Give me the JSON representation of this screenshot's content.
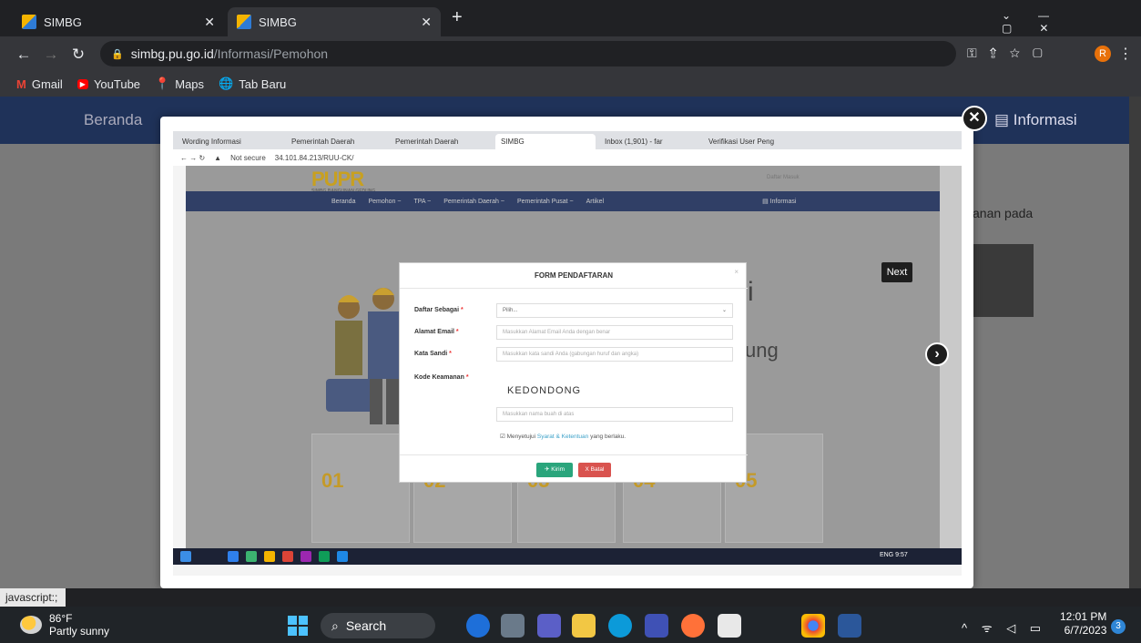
{
  "browser": {
    "tabs": [
      {
        "title": "SIMBG"
      },
      {
        "title": "SIMBG"
      }
    ],
    "url_host": "simbg.pu.go.id",
    "url_path": "/Informasi/Pemohon",
    "bookmarks": [
      "Gmail",
      "YouTube",
      "Maps",
      "Tab Baru"
    ],
    "profile_initial": "R",
    "status_tip": "javascript:;"
  },
  "host_page": {
    "nav_left": "Beranda",
    "nav_right": "Informasi",
    "side_text": "anan pada"
  },
  "screenshot": {
    "tabs": [
      "Wording Informasi",
      "Pemerintah Daerah",
      "Pemerintah Daerah",
      "SIMBG",
      "Inbox (1,901) - far",
      "Verifikasi User Peng"
    ],
    "url_label": "Not secure",
    "url": "34.101.84.213/RUU-CK/",
    "logo": "PUPR",
    "logo_sub": "SIMBG BANGUNAN GEDUNG",
    "login_links": "Daftar  Masuk",
    "nav": [
      "Beranda",
      "Pemohon ~",
      "TPA ~",
      "Pemerintah Daerah ~",
      "Pemerintah Pusat ~",
      "Artikel"
    ],
    "nav_info": "Informasi",
    "bg_text1": "si",
    "bg_text2": "ung",
    "next_label": "Next",
    "cards": [
      "01",
      "02",
      "03",
      "04",
      "05"
    ],
    "taskbar_time": "9:57",
    "taskbar_lang": "ENG"
  },
  "form": {
    "title": "FORM PENDAFTARAN",
    "daftar_label": "Daftar Sebagai",
    "daftar_value": "Pilih...",
    "email_label": "Alamat Email",
    "email_placeholder": "Masukkan Alamat Email Anda dengan benar",
    "password_label": "Kata Sandi",
    "password_placeholder": "Masukkan kata sandi Anda (gabungan huruf dan angka)",
    "captcha_label": "Kode Keamanan",
    "captcha_text": "KEDONDONG",
    "captcha_placeholder": "Masukkan nama buah di atas",
    "agree_prefix": "Menyetujui",
    "agree_link": "Syarat & Ketentuan",
    "agree_suffix": "yang berlaku.",
    "submit": "Kirim",
    "cancel": "X Batal"
  },
  "taskbar": {
    "weather_temp": "86°F",
    "weather_desc": "Partly sunny",
    "search": "Search",
    "time": "12:01 PM",
    "date": "6/7/2023",
    "notif": "3"
  }
}
